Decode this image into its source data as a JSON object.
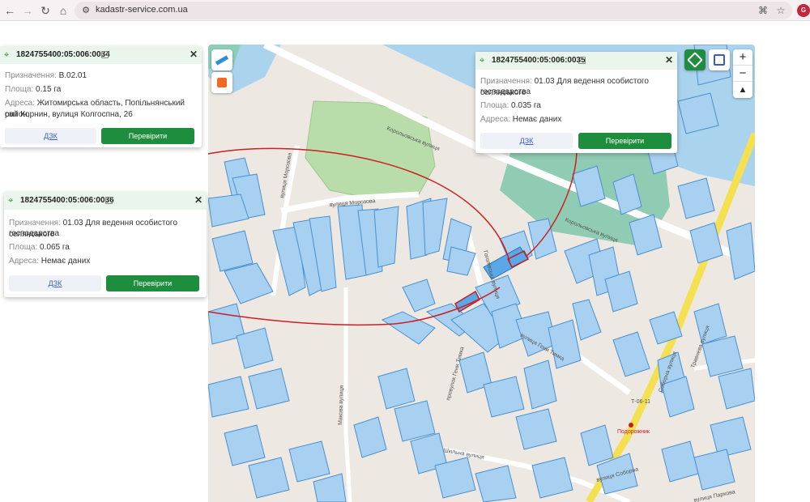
{
  "browser": {
    "url": "kadastr-service.com.ua",
    "back_icon": "←",
    "forward_icon": "→",
    "reload_icon": "↻",
    "home_icon": "⌂",
    "ext_label": "G"
  },
  "map": {
    "streets": [
      "Корольовська вулиця",
      "вулиця Морозова",
      "вулиця Морозова",
      "Соборна вулиця",
      "провулок Гени Тимка",
      "вулиця Гени Тимка",
      "Макова вулиця",
      "Шкільна вулиця",
      "вулиця Соборна",
      "Травнева вулиця",
      "Гоголівська вулиця",
      "вулиця Паркова",
      "Т-06-11",
      "Подорожник"
    ],
    "colors": {
      "water": "#aad3ee",
      "parcel": "#a8d0f0",
      "parcel_stroke": "#4a90d0",
      "green": "#b8dcaa",
      "road": "#ffffff",
      "highway": "#f4e050",
      "trace": "#cc1f1f"
    }
  },
  "cards": [
    {
      "id": "1824755400:05:006:0034",
      "purpose_label": "Призначення:",
      "purpose": "В.02.01",
      "area_label": "Площа:",
      "area": "0.15 га",
      "address_label": "Адреса:",
      "address_line1": "Житомирська область, Попільнянський район,",
      "address_line2": "смт Корнин, вулиця Колгоспна, 26",
      "dzk_label": "ДЗК",
      "check_label": "Перевірити"
    },
    {
      "id": "1824755400:05:006:0036",
      "purpose_label": "Призначення:",
      "purpose_line1": "01.03 Для ведення особистого селянського",
      "purpose_line2": "господарства",
      "area_label": "Площа:",
      "area": "0.065 га",
      "address_label": "Адреса:",
      "address": "Немає даних",
      "dzk_label": "ДЗК",
      "check_label": "Перевірити"
    },
    {
      "id": "1824755400:05:006:0035",
      "purpose_label": "Призначення:",
      "purpose_line1": "01.03 Для ведення особистого селянського",
      "purpose_line2": "господарства",
      "area_label": "Площа:",
      "area": "0.035 га",
      "address_label": "Адреса:",
      "address": "Немає даних",
      "dzk_label": "ДЗК",
      "check_label": "Перевірити"
    }
  ],
  "zoom": {
    "in": "+",
    "out": "−",
    "reset": "▲"
  }
}
